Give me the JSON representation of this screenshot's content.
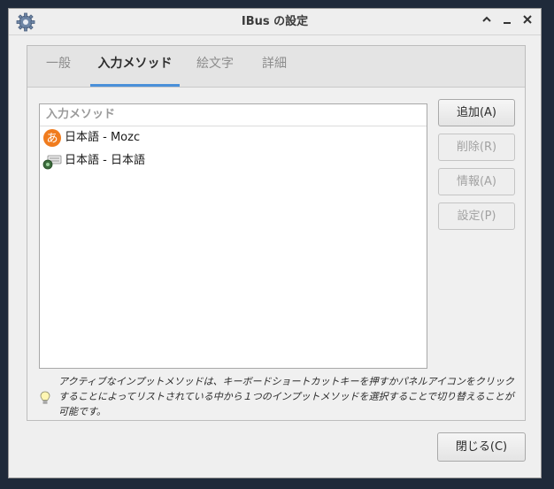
{
  "window": {
    "title": "IBus の設定"
  },
  "tabs": [
    {
      "label": "一般",
      "active": false
    },
    {
      "label": "入力メソッド",
      "active": true
    },
    {
      "label": "絵文字",
      "active": false
    },
    {
      "label": "詳細",
      "active": false
    }
  ],
  "input_methods": {
    "header": "入力メソッド",
    "items": [
      {
        "label": "日本語 - Mozc",
        "icon": "mozc-icon"
      },
      {
        "label": "日本語 - 日本語",
        "icon": "keyboard-icon"
      }
    ]
  },
  "buttons": {
    "add": "追加(A)",
    "remove": "削除(R)",
    "info": "情報(A)",
    "settings": "設定(P)",
    "close": "閉じる(C)"
  },
  "hint": "アクティブなインプットメソッドは、キーボードショートカットキーを押すかパネルアイコンをクリックすることによってリストされている中から１つのインプットメソッドを選択することで切り替えることが可能です。",
  "colors": {
    "accent": "#4a90d9",
    "background": "#1f2a3a"
  }
}
